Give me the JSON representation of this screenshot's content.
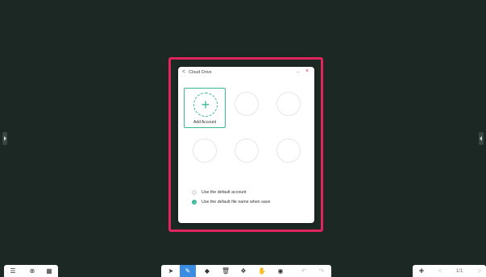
{
  "dialog": {
    "title": "Cloud Drive",
    "back_icon": "<",
    "minimize_icon": "–",
    "close_icon": "×",
    "add_account": {
      "plus_icon": "+",
      "label": "Add Account"
    },
    "options": [
      {
        "label": "Use the default account",
        "checked": false
      },
      {
        "label": "Use the default file name when save",
        "checked": true
      }
    ]
  },
  "toolbar_left": [
    {
      "name": "menu-icon",
      "glyph": "☰"
    },
    {
      "name": "close-circle-icon",
      "glyph": "⊗"
    },
    {
      "name": "qr-code-icon",
      "glyph": "▦"
    }
  ],
  "toolbar_center": [
    {
      "name": "select-icon",
      "glyph": "➤",
      "active": false,
      "muted": false
    },
    {
      "name": "pen-icon",
      "glyph": "✎",
      "active": true,
      "muted": false
    },
    {
      "name": "eraser-icon",
      "glyph": "◆",
      "active": false,
      "muted": false
    },
    {
      "name": "delete-icon",
      "glyph": "🗑",
      "active": false,
      "muted": false
    },
    {
      "name": "shapes-icon",
      "glyph": "❖",
      "active": false,
      "muted": false
    },
    {
      "name": "hand-icon",
      "glyph": "✋",
      "active": false,
      "muted": false
    },
    {
      "name": "view-icon",
      "glyph": "◉",
      "active": false,
      "muted": false
    },
    {
      "name": "undo-icon",
      "glyph": "↶",
      "active": false,
      "muted": true
    },
    {
      "name": "redo-icon",
      "glyph": "↷",
      "active": false,
      "muted": true
    }
  ],
  "toolbar_right": {
    "add_page": "+",
    "prev_page": "<",
    "page_indicator": "1/1",
    "next_page": ">"
  },
  "colors": {
    "background": "#1c2823",
    "highlight": "#e0245e",
    "accent": "#3ab89c",
    "active_tool": "#3a8de0"
  }
}
